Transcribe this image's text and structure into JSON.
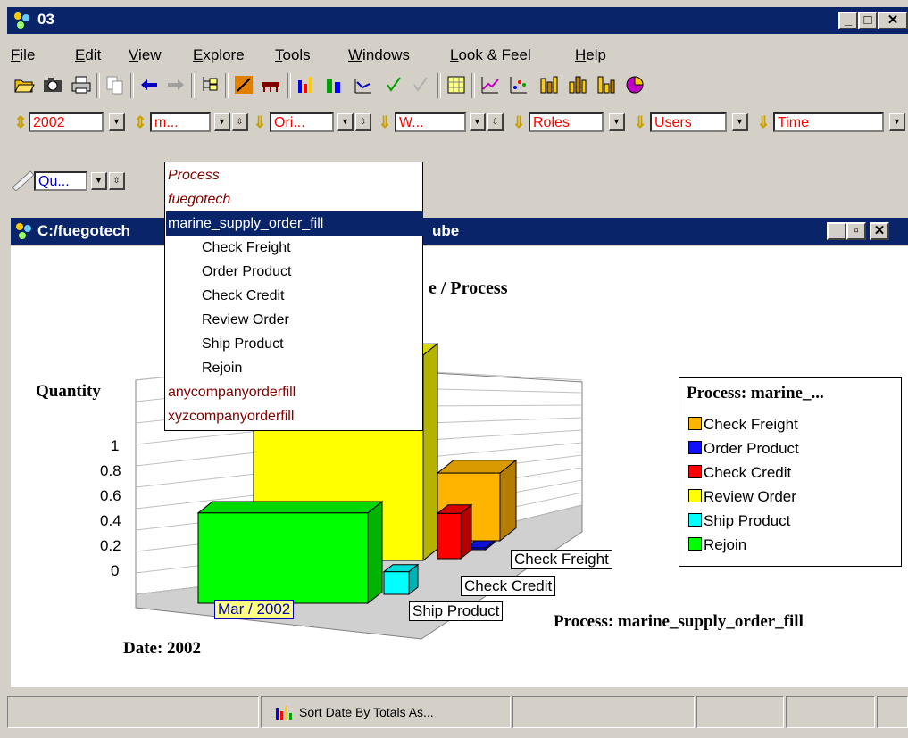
{
  "app": {
    "title": "03"
  },
  "menu": [
    "File",
    "Edit",
    "View",
    "Explore",
    "Tools",
    "Windows",
    "Look & Feel",
    "Help"
  ],
  "dimension_bar": {
    "year_value": "2002",
    "process_value": "m...",
    "ori_value": "Ori...",
    "w_value": "W...",
    "roles_value": "Roles",
    "users_value": "Users",
    "time_value": "Time",
    "measure_value": "Qu..."
  },
  "dropdown": {
    "items": [
      {
        "label": "Process",
        "style": "italic"
      },
      {
        "label": "fuegotech",
        "style": "italic"
      },
      {
        "label": "marine_supply_order_fill",
        "style": "selected"
      },
      {
        "label": "Check Freight",
        "style": "child"
      },
      {
        "label": "Order Product",
        "style": "child"
      },
      {
        "label": "Check Credit",
        "style": "child"
      },
      {
        "label": "Review Order",
        "style": "child"
      },
      {
        "label": "Ship Product",
        "style": "child"
      },
      {
        "label": "Rejoin",
        "style": "child"
      },
      {
        "label": "anycompanyorderfill",
        "style": "plain"
      },
      {
        "label": "xyzcompanyorderfill",
        "style": "plain"
      }
    ]
  },
  "inner_window": {
    "title_left": "C:/fuegotech",
    "title_right": "ube"
  },
  "chart_data": {
    "type": "bar",
    "title": "e / Process",
    "ylabel": "Quantity",
    "xlabel": "Date: 2002",
    "footer_label": "Process: marine_supply_order_fill",
    "categories": [
      "Mar / 2002"
    ],
    "yticks": [
      "1",
      "0.8",
      "0.6",
      "0.4",
      "0.2",
      "0"
    ],
    "ylim": [
      0,
      1
    ],
    "depth_labels": [
      "Check Freight",
      "Check Credit",
      "Ship Product"
    ],
    "legend_title": "Process: marine_...",
    "series": [
      {
        "name": "Check Freight",
        "color": "#ffb400",
        "values": [
          0.3
        ]
      },
      {
        "name": "Order Product",
        "color": "#1010ff",
        "values": [
          0.0
        ]
      },
      {
        "name": "Check Credit",
        "color": "#ff0000",
        "values": [
          0.2
        ]
      },
      {
        "name": "Review Order",
        "color": "#ffff00",
        "values": [
          1.0
        ]
      },
      {
        "name": "Ship Product",
        "color": "#00ffff",
        "values": [
          0.1
        ]
      },
      {
        "name": "Rejoin",
        "color": "#00ff00",
        "values": [
          0.4
        ]
      }
    ]
  },
  "status": {
    "sort_text": "Sort Date By Totals  As..."
  }
}
